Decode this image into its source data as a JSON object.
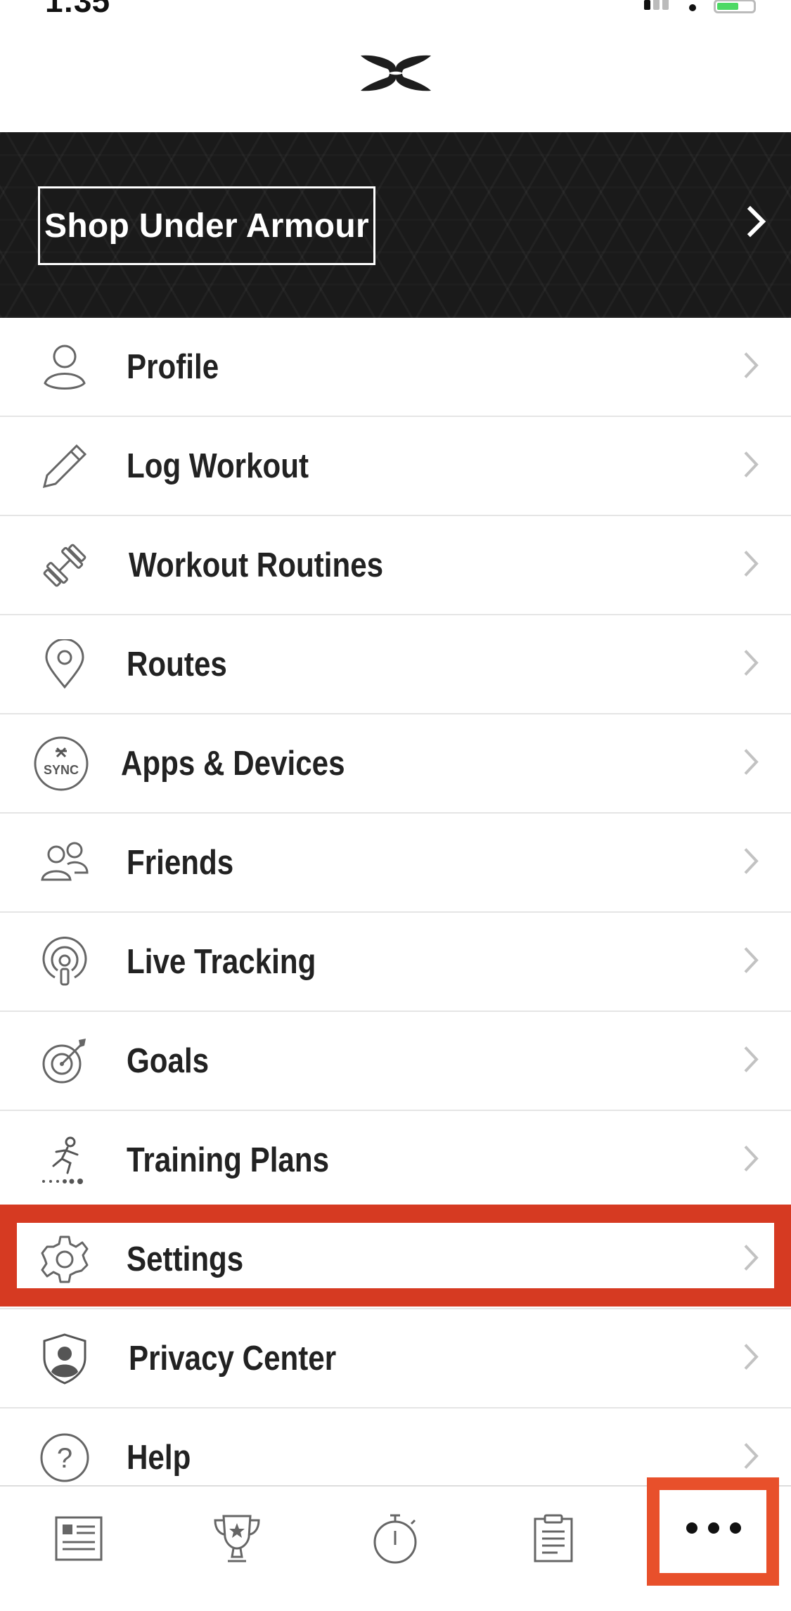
{
  "status_bar": {
    "time": "1:35"
  },
  "banner": {
    "shop_label": "Shop Under Armour"
  },
  "menu": {
    "items": [
      {
        "label": "Profile",
        "icon": "profile-icon"
      },
      {
        "label": "Log Workout",
        "icon": "pencil-icon"
      },
      {
        "label": "Workout Routines",
        "icon": "dumbbell-icon"
      },
      {
        "label": "Routes",
        "icon": "map-pin-icon"
      },
      {
        "label": "Apps & Devices",
        "icon": "sync-icon",
        "icon_text": "SYNC"
      },
      {
        "label": "Friends",
        "icon": "friends-icon"
      },
      {
        "label": "Live Tracking",
        "icon": "live-tracking-icon"
      },
      {
        "label": "Goals",
        "icon": "target-icon"
      },
      {
        "label": "Training Plans",
        "icon": "runner-icon"
      },
      {
        "label": "Settings",
        "icon": "gear-icon"
      },
      {
        "label": "Privacy Center",
        "icon": "shield-icon"
      },
      {
        "label": "Help",
        "icon": "help-icon",
        "icon_text": "?"
      }
    ]
  },
  "tab_bar": {
    "tabs": [
      "feed-tab",
      "challenges-tab",
      "record-tab",
      "training-log-tab",
      "more-tab"
    ]
  },
  "colors": {
    "highlight": "#d63a22",
    "banner_bg": "#1a1a1a"
  }
}
